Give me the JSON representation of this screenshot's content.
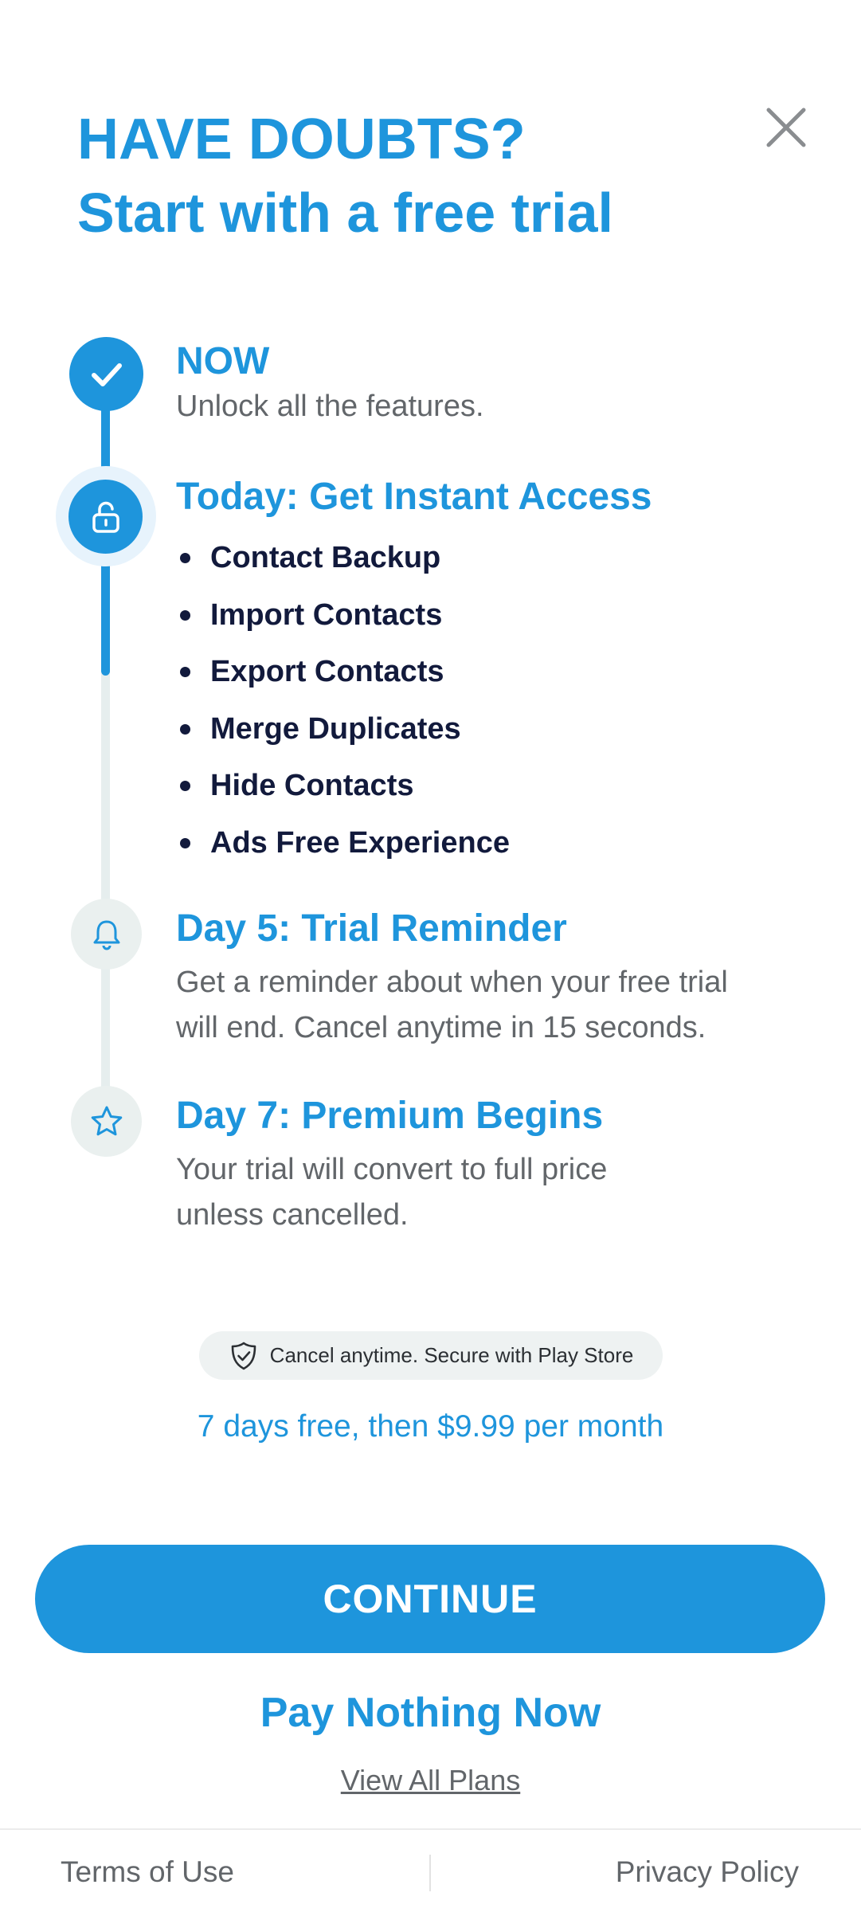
{
  "header": {
    "headline": "HAVE DOUBTS?",
    "subheadline": "Start with a free trial",
    "close_icon": "close-icon"
  },
  "timeline": {
    "now": {
      "title": "NOW",
      "description": "Unlock all the features.",
      "icon": "checkmark-icon"
    },
    "access": {
      "title": "Today: Get Instant Access",
      "icon": "unlock-icon",
      "features": [
        "Contact Backup",
        "Import Contacts",
        "Export Contacts",
        "Merge Duplicates",
        "Hide Contacts",
        "Ads Free Experience"
      ]
    },
    "reminder": {
      "title": "Day 5: Trial Reminder",
      "description_line1": "Get a reminder about when your free trial",
      "description_line2": "will end. Cancel anytime in 15 seconds.",
      "icon": "bell-icon"
    },
    "premium": {
      "title": "Day 7: Premium Begins",
      "description_line1": "Your trial will convert to full price",
      "description_line2": "unless cancelled.",
      "icon": "star-icon"
    }
  },
  "secure_badge": {
    "text": "Cancel anytime. Secure with Play Store",
    "icon": "shield-check-icon"
  },
  "pricing": {
    "text": "7 days free, then $9.99 per month"
  },
  "actions": {
    "continue_label": "CONTINUE",
    "pay_nothing_label": "Pay Nothing Now",
    "view_plans_label": "View All Plans"
  },
  "footer": {
    "terms_label": "Terms of Use",
    "privacy_label": "Privacy Policy"
  },
  "colors": {
    "accent": "#1e95dc",
    "text_dark": "#121a3c",
    "text_muted": "#62666a",
    "node_inactive": "#eaf0ef"
  }
}
